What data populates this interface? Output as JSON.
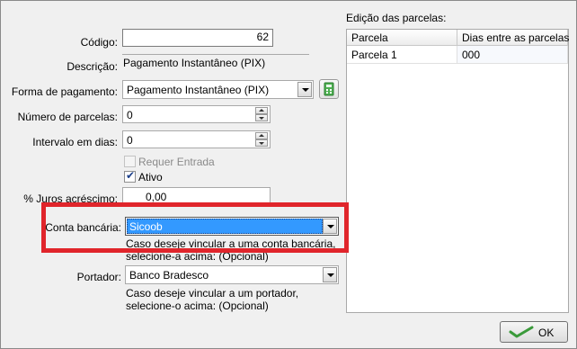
{
  "form": {
    "codigo_label": "Código:",
    "codigo_value": "62",
    "descricao_label": "Descrição:",
    "descricao_value": "Pagamento Instantâneo (PIX)",
    "forma_label": "Forma de pagamento:",
    "forma_value": "Pagamento Instantâneo (PIX)",
    "calc_icon": "calculator-icon",
    "parcelas_label": "Número de parcelas:",
    "parcelas_value": "0",
    "intervalo_label": "Intervalo em dias:",
    "intervalo_value": "0",
    "requer_entrada_label": "Requer Entrada",
    "requer_entrada_checked": false,
    "ativo_label": "Ativo",
    "ativo_checked": true,
    "juros_label": "% Juros acréscimo:",
    "juros_value": "0,00",
    "conta_label": "Conta bancária:",
    "conta_value": "Sicoob",
    "conta_hint_1": "Caso deseje vincular a uma conta bancária,",
    "conta_hint_2": "selecione-a acima: (Opcional)",
    "portador_label": "Portador:",
    "portador_value": "Banco Bradesco",
    "portador_hint_1": "Caso deseje vincular a um portador,",
    "portador_hint_2": "selecione-o acima: (Opcional)"
  },
  "parcelas_panel": {
    "title": "Edição das parcelas:",
    "columns": [
      "Parcela",
      "Dias entre as parcelas"
    ],
    "rows": [
      {
        "parcela": "Parcela 1",
        "dias": "000"
      }
    ]
  },
  "footer": {
    "ok_label": "OK",
    "ok_icon": "checkmark-icon"
  },
  "colors": {
    "highlight_box": "#e0252b",
    "selection": "#3399ff",
    "check_green": "#3a9a3a"
  }
}
